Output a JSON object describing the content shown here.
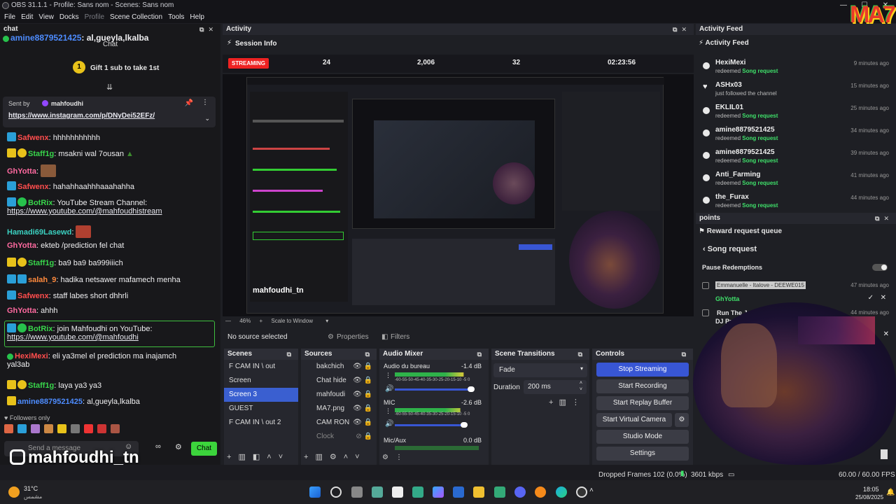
{
  "titlebar": {
    "title": "OBS 31.1.1 - Profile: Sans nom - Scenes: Sans nom"
  },
  "menu": [
    "File",
    "Edit",
    "View",
    "Docks",
    "Profile",
    "Scene Collection",
    "Tools",
    "Help"
  ],
  "chat": {
    "dock_title": "chat",
    "top_user": "amine8879521425",
    "top_text": ": al,gueyla,lkalba",
    "subheader": "Chat",
    "gift_text": "Gift 1 sub to take 1st",
    "pinned": {
      "sent_by": "Sent by",
      "user": "mahfoudhi",
      "link": "https://www.instagram.com/p/DNyDei52EFz/"
    },
    "messages": [
      {
        "user": "Safwenx",
        "text": ": hhhhhhhhhhh"
      },
      {
        "user": "Staff1g",
        "text": ": msakni wal 7ousan"
      },
      {
        "user": "GhYotta",
        "text": ":"
      },
      {
        "user": "Safwenx",
        "text": ": hahahhaahhhaaahahha"
      },
      {
        "user": "BotRix",
        "text": ": YouTube Stream Channel:",
        "link": "https://www.youtube.com/@mahfoudhistream"
      },
      {
        "user": "Hamadi69Lasewd",
        "text": ":"
      },
      {
        "user": "GhYotta",
        "text": ": ekteb /prediction fel chat"
      },
      {
        "user": "Staff1g",
        "text": ": ba9 ba9 ba999iiich"
      },
      {
        "user": "salah_9",
        "text": ": hadika netsawer mafamech menha"
      },
      {
        "user": "Safwenx",
        "text": ": staff labes short dhhrli"
      },
      {
        "user": "GhYotta",
        "text": ": ahhh"
      },
      {
        "user": "BotRix",
        "text": ": join Mahfoudhi on YouTube:",
        "link": "https://www.youtube.com/@mahfoudhi"
      },
      {
        "user": "HexiMexi",
        "text": ": eli ya3mel el prediction ma inajamch",
        "text2": "yal3ab"
      },
      {
        "user": "Staff1g",
        "text": ": laya ya3 ya3"
      },
      {
        "user": "amine8879521425",
        "text": ": al,gueyla,lkalba"
      }
    ],
    "followers_only": "Followers only",
    "input_placeholder": "Send a message",
    "chat_button": "Chat",
    "overlay_handle": "mahfoudhi_tn"
  },
  "activity": {
    "dock_title": "Activity",
    "session_label": "Session Info",
    "streaming_badge": "STREAMING",
    "stats": [
      "24",
      "2,006",
      "32",
      "02:23:56"
    ],
    "zoom": "46%",
    "scale_mode": "Scale to Window",
    "no_source": "No source selected",
    "properties": "Properties",
    "filters": "Filters"
  },
  "scenes": {
    "title": "Scenes",
    "items": [
      "F CAM IN \\ out",
      "Screen",
      "Screen 3",
      "GUEST",
      "F CAM IN \\ out 2"
    ],
    "selected": 2
  },
  "sources": {
    "title": "Sources",
    "items": [
      "bakchich",
      "Chat hide",
      "mahfoudi",
      "MA7.png",
      "CAM RON",
      "Clock"
    ]
  },
  "mixer": {
    "title": "Audio Mixer",
    "channels": [
      {
        "name": "Audio du bureau",
        "db": "-1.4 dB",
        "level": 0.82
      },
      {
        "name": "MIC",
        "db": "-2.6 dB",
        "level": 0.78
      },
      {
        "name": "Mic/Aux",
        "db": "0.0 dB",
        "level": 0.0
      }
    ],
    "scale": "-60-55-50-45-40-35-30-25-20-15-10 -5 0"
  },
  "transitions": {
    "title": "Scene Transitions",
    "type": "Fade",
    "duration_label": "Duration",
    "duration": "200 ms"
  },
  "controls": {
    "title": "Controls",
    "buttons": [
      "Stop Streaming",
      "Start Recording",
      "Start Replay Buffer",
      "Start Virtual Camera",
      "Studio Mode",
      "Settings"
    ]
  },
  "feed": {
    "dock_title": "Activity Feed",
    "header": "Activity Feed",
    "items": [
      {
        "name": "HexiMexi",
        "action": "redeemed",
        "reward": "Song request",
        "time": "9 minutes ago"
      },
      {
        "name": "ASHx03",
        "action": "just followed the channel",
        "reward": "",
        "time": "15 minutes ago"
      },
      {
        "name": "EKLIL01",
        "action": "redeemed",
        "reward": "Song request",
        "time": "25 minutes ago"
      },
      {
        "name": "amine8879521425",
        "action": "redeemed",
        "reward": "Song request",
        "time": "34 minutes ago"
      },
      {
        "name": "amine8879521425",
        "action": "redeemed",
        "reward": "Song request",
        "time": "39 minutes ago"
      },
      {
        "name": "Anti_Farming",
        "action": "redeemed",
        "reward": "Song request",
        "time": "41 minutes ago"
      },
      {
        "name": "the_Furax",
        "action": "redeemed",
        "reward": "Song request",
        "time": "44 minutes ago"
      }
    ]
  },
  "points": {
    "dock_title": "points",
    "queue_title": "Reward request queue",
    "back_label": "Song request",
    "pause_label": "Pause Redemptions",
    "requests": [
      {
        "title": "Emmanuelle - Italove - DEEWE015",
        "user": "GhYotta",
        "time": "47 minutes ago"
      },
      {
        "title": "Run The Jew...",
        "user": "DJ Pre...",
        "time": "44 minutes ago"
      }
    ]
  },
  "statusbar": {
    "dropped": "Dropped Frames 102 (0.0%)",
    "bitrate": "3601 kbps",
    "fps": "60.00 / 60.00 FPS"
  },
  "taskbar": {
    "temp": "31°C",
    "location": "مشمس",
    "time": "18:05",
    "date": "25/08/2025"
  },
  "logo_text": "MA7"
}
